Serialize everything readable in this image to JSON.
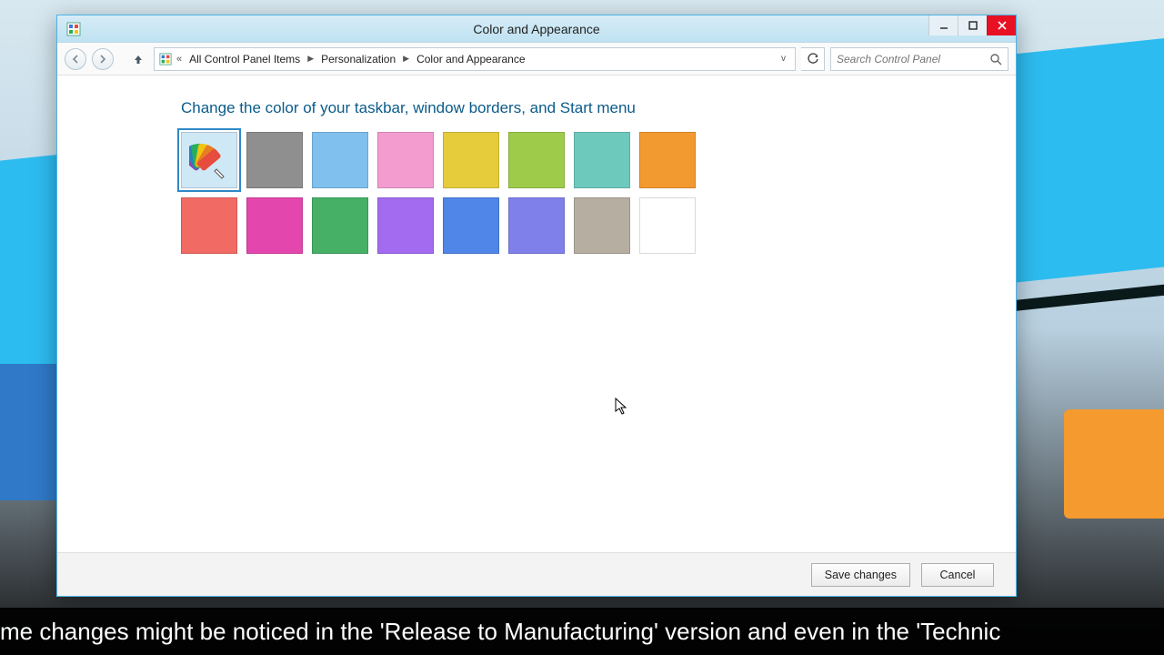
{
  "window": {
    "title": "Color and Appearance"
  },
  "breadcrumb": {
    "items": [
      "All Control Panel Items",
      "Personalization",
      "Color and Appearance"
    ]
  },
  "search": {
    "placeholder": "Search Control Panel"
  },
  "heading": "Change the color of your taskbar, window borders, and Start menu",
  "swatches": {
    "auto_label": "Automatic",
    "colors": [
      "auto",
      "#8f8f8f",
      "#7fc0ee",
      "#f39ccf",
      "#e6cc3a",
      "#9fcb4b",
      "#6ec9bd",
      "#f29a30",
      "#f16a64",
      "#e346ac",
      "#45b066",
      "#a36cf0",
      "#4f86e8",
      "#7f80ea",
      "#b7aea2",
      "#ffffff"
    ],
    "selected_index": 0
  },
  "footer": {
    "save_label": "Save changes",
    "cancel_label": "Cancel"
  },
  "caption": "me changes might be noticed in the 'Release to Manufacturing' version and even in the 'Technic"
}
